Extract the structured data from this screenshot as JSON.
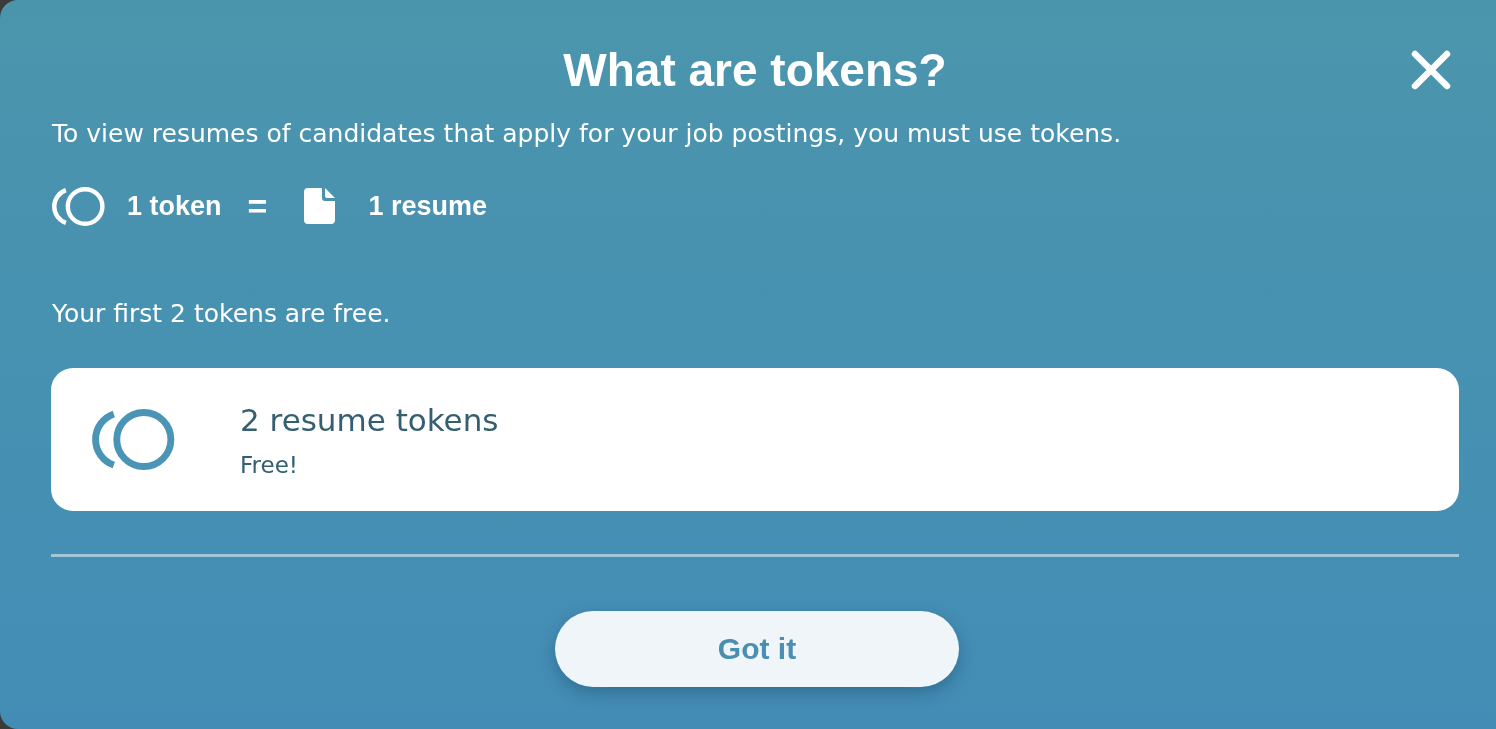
{
  "dialog": {
    "title": "What are tokens?",
    "description": "To view resumes of candidates that apply for your job postings, you must use tokens.",
    "equation": {
      "left": "1 token",
      "operator": "=",
      "right": "1 resume"
    },
    "note": "Your first 2 tokens are free.",
    "offer": {
      "title": "2 resume tokens",
      "subtitle": "Free!"
    },
    "button": {
      "label": "Got it"
    }
  }
}
